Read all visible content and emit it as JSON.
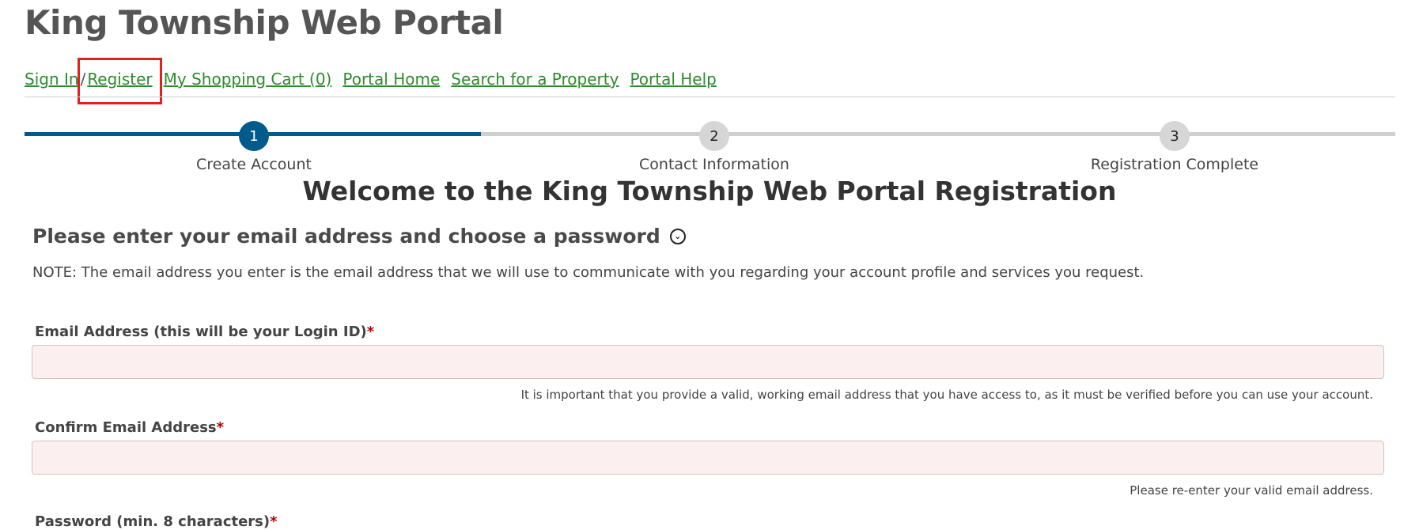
{
  "header": {
    "title": "King Township Web Portal"
  },
  "nav": {
    "sign_in": "Sign In",
    "separator": "/",
    "register": "Register",
    "cart": "My Shopping Cart (0)",
    "portal_home": "Portal Home",
    "search_property": "Search for a Property",
    "portal_help": "Portal Help"
  },
  "progress": {
    "completed_fraction": 0.333,
    "steps": [
      {
        "number": "1",
        "label": "Create Account",
        "active": true
      },
      {
        "number": "2",
        "label": "Contact Information",
        "active": false
      },
      {
        "number": "3",
        "label": "Registration Complete",
        "active": false
      }
    ]
  },
  "main": {
    "welcome": "Welcome to the King Township Web Portal Registration",
    "section_heading": "Please enter your email address and choose a password",
    "section_toggle_icon": "chevron-down-icon",
    "note": "NOTE: The email address you enter is the email address that we will use to communicate with you regarding your account profile and services you request.",
    "fields": {
      "email_label": "Email Address (this will be your Login ID)",
      "email_value": "",
      "email_hint": "It is important that you provide a valid, working email address that you have access to, as it must be verified before you can use your account.",
      "confirm_label": "Confirm Email Address",
      "confirm_value": "",
      "confirm_hint": "Please re-enter your valid email address.",
      "password_label": "Password (min. 8 characters)",
      "required_marker": "*"
    }
  },
  "colors": {
    "link": "#2e8b2e",
    "accent": "#005a8c",
    "highlight": "#e32020",
    "input_bg": "#fbefef"
  }
}
